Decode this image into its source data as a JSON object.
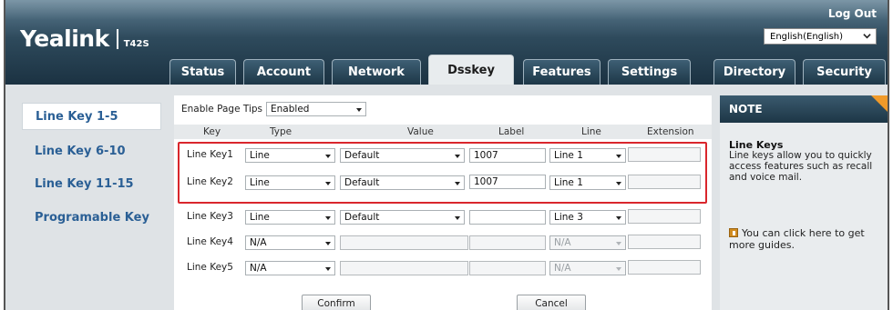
{
  "header": {
    "logo": "Yealink",
    "model": "T42S",
    "logout_label": "Log Out",
    "language": "English(English)"
  },
  "tabs": [
    {
      "label": "Status"
    },
    {
      "label": "Account"
    },
    {
      "label": "Network"
    },
    {
      "label": "Dsskey",
      "active": true
    },
    {
      "label": "Features"
    },
    {
      "label": "Settings"
    },
    {
      "label": "Directory"
    },
    {
      "label": "Security"
    }
  ],
  "sidebar": {
    "items": [
      {
        "label": "Line Key 1-5",
        "active": true
      },
      {
        "label": "Line Key 6-10"
      },
      {
        "label": "Line Key 11-15"
      },
      {
        "label": "Programable Key"
      }
    ]
  },
  "main": {
    "page_tips_label": "Enable Page Tips",
    "page_tips_value": "Enabled",
    "columns": [
      "Key",
      "Type",
      "Value",
      "Label",
      "Line",
      "Extension"
    ],
    "rows": [
      {
        "key": "Line Key1",
        "type": "Line",
        "value": "Default",
        "label": "1007",
        "line": "Line 1",
        "extension": ""
      },
      {
        "key": "Line Key2",
        "type": "Line",
        "value": "Default",
        "label": "1007",
        "line": "Line 1",
        "extension": ""
      },
      {
        "key": "Line Key3",
        "type": "Line",
        "value": "Default",
        "label": "",
        "line": "Line 3",
        "extension": ""
      },
      {
        "key": "Line Key4",
        "type": "N/A",
        "value": "",
        "label": "",
        "line": "N/A",
        "extension": ""
      },
      {
        "key": "Line Key5",
        "type": "N/A",
        "value": "",
        "label": "",
        "line": "N/A",
        "extension": ""
      }
    ],
    "confirm_label": "Confirm",
    "cancel_label": "Cancel"
  },
  "note": {
    "heading": "NOTE",
    "title": "Line Keys",
    "body": "Line keys allow you to quickly access features such as recall and voice mail.",
    "guide": "You can click here to get more guides."
  },
  "colors": {
    "header_dark": "#1b3242",
    "sidebar_link": "#2a5f95",
    "highlight": "#d9262c",
    "note_accent": "#f09a2a"
  }
}
